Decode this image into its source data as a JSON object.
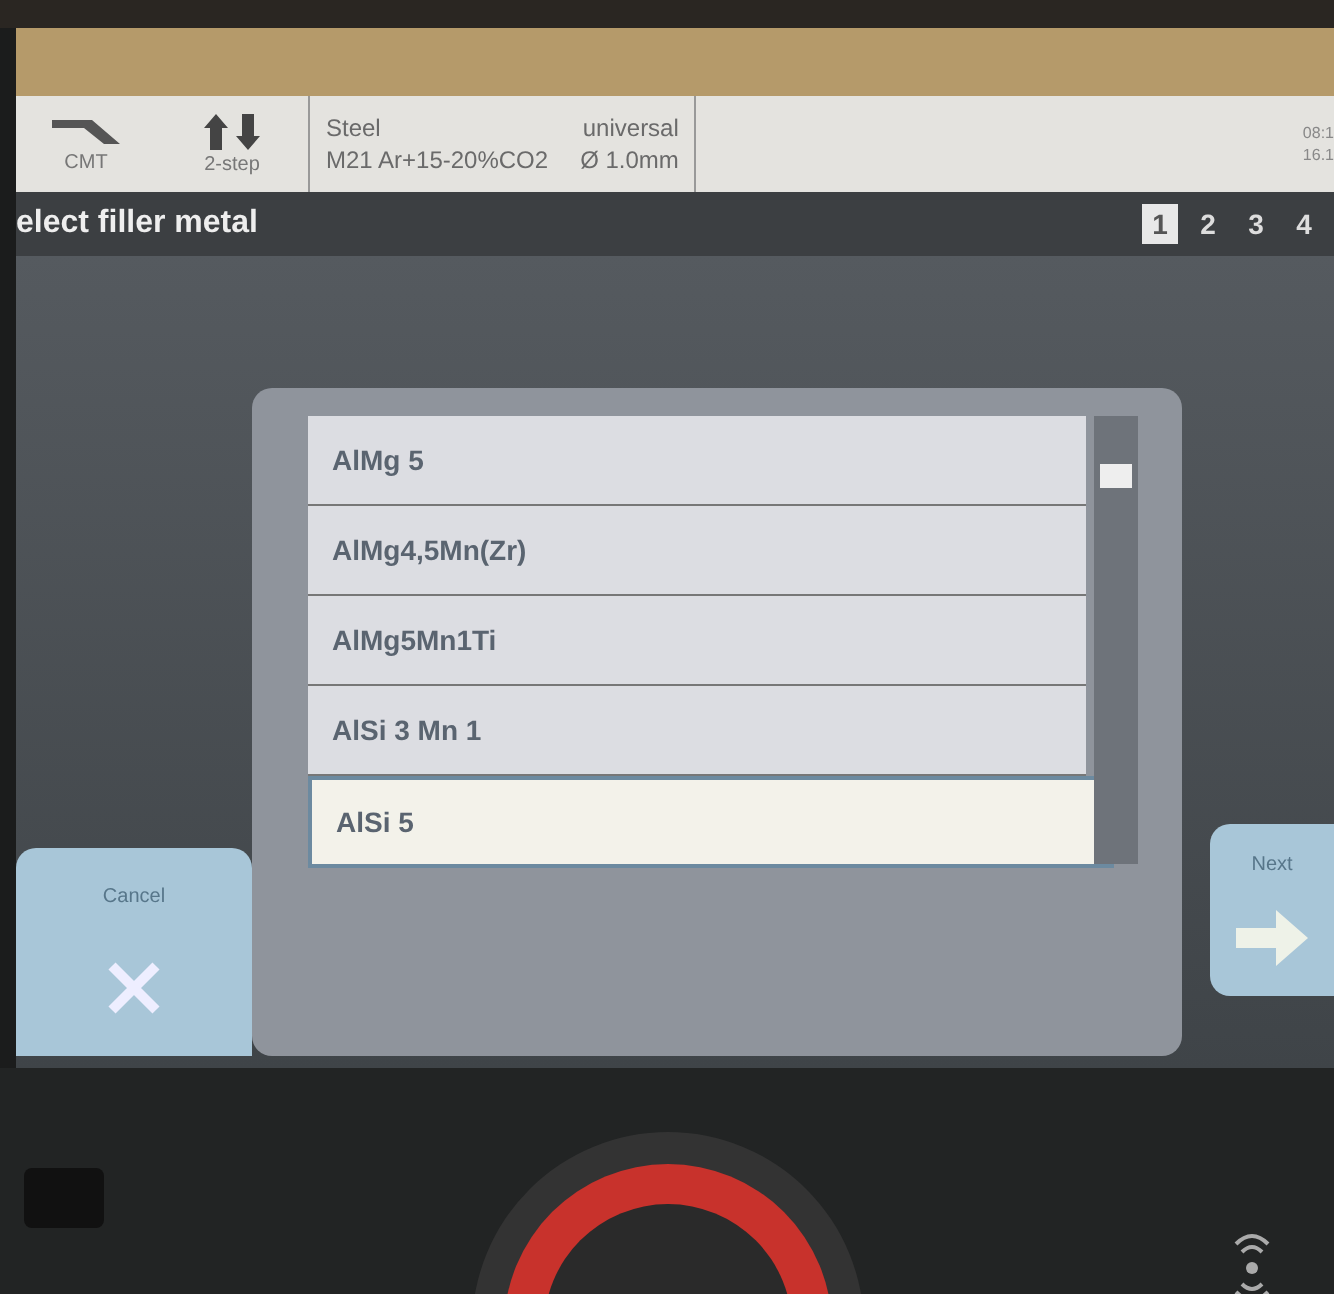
{
  "status_bar": {
    "process": "CMT",
    "mode": "2-step",
    "material": "Steel",
    "gas": "M21 Ar+15-20%CO2",
    "wire_type": "universal",
    "wire_diameter": "Ø  1.0mm",
    "time": "08:1",
    "date": "16.1"
  },
  "title_bar": {
    "title": "elect filler metal",
    "steps": [
      {
        "label": "1",
        "selected": true
      },
      {
        "label": "2",
        "selected": false
      },
      {
        "label": "3",
        "selected": false
      },
      {
        "label": "4",
        "selected": false
      }
    ]
  },
  "list": {
    "items": [
      {
        "label": "AlMg 5",
        "selected": false
      },
      {
        "label": "AlMg4,5Mn(Zr)",
        "selected": false
      },
      {
        "label": "AlMg5Mn1Ti",
        "selected": false
      },
      {
        "label": "AlSi 3 Mn 1",
        "selected": false
      },
      {
        "label": "AlSi 5",
        "selected": true
      }
    ]
  },
  "buttons": {
    "cancel": "Cancel",
    "next": "Next"
  }
}
